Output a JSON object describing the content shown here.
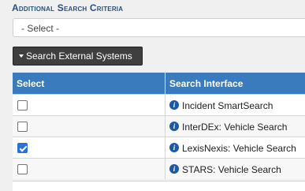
{
  "section": {
    "title": "Additional Search Criteria"
  },
  "criteria_select": {
    "value": "- Select -"
  },
  "external_button": {
    "label": "Search External Systems"
  },
  "table": {
    "headers": [
      "Select",
      "Search Interface"
    ],
    "rows": [
      {
        "checked": false,
        "label": "Incident SmartSearch"
      },
      {
        "checked": false,
        "label": "InterDEx: Vehicle Search"
      },
      {
        "checked": true,
        "label": "LexisNexis: Vehicle Search"
      },
      {
        "checked": false,
        "label": "STARS: Vehicle Search"
      }
    ]
  },
  "colors": {
    "title": "#27507e",
    "header_bg": "#3a7bbd",
    "button_bg": "#3f3f3f",
    "checkbox_checked": "#2b6fd9",
    "info_icon": "#1d5aa6"
  }
}
